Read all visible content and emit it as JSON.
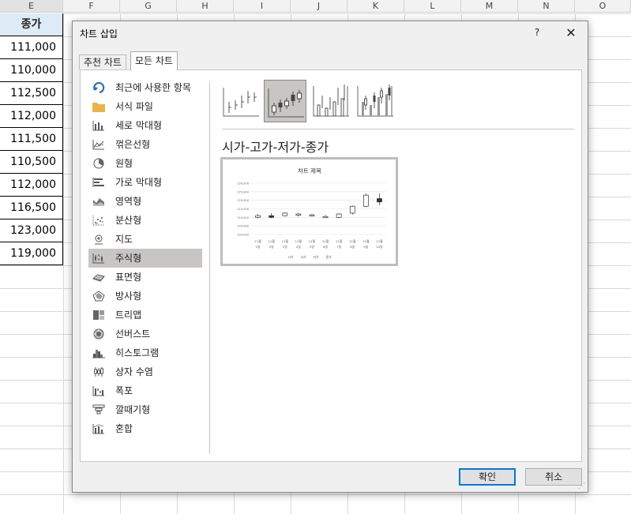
{
  "spreadsheet": {
    "columns": [
      "E",
      "F",
      "G",
      "H",
      "I",
      "J",
      "K",
      "L",
      "M",
      "N",
      "O"
    ],
    "header_cell": "종가",
    "values": [
      "111,000",
      "110,000",
      "112,500",
      "112,000",
      "111,500",
      "110,500",
      "112,000",
      "116,500",
      "123,000",
      "119,000"
    ]
  },
  "dialog": {
    "title": "차트 삽입",
    "help": "?",
    "close": "✕",
    "tabs": [
      {
        "label": "추천 차트",
        "active": false
      },
      {
        "label": "모든 차트",
        "active": true
      }
    ],
    "categories": [
      {
        "label": "최근에 사용한 항목",
        "icon": "recent-icon"
      },
      {
        "label": "서식 파일",
        "icon": "folder-icon"
      },
      {
        "label": "세로 막대형",
        "icon": "column-chart-icon"
      },
      {
        "label": "꺾은선형",
        "icon": "line-chart-icon"
      },
      {
        "label": "원형",
        "icon": "pie-chart-icon"
      },
      {
        "label": "가로 막대형",
        "icon": "bar-chart-icon"
      },
      {
        "label": "영역형",
        "icon": "area-chart-icon"
      },
      {
        "label": "분산형",
        "icon": "scatter-chart-icon"
      },
      {
        "label": "지도",
        "icon": "map-icon"
      },
      {
        "label": "주식형",
        "icon": "stock-chart-icon"
      },
      {
        "label": "표면형",
        "icon": "surface-chart-icon"
      },
      {
        "label": "방사형",
        "icon": "radar-chart-icon"
      },
      {
        "label": "트리맵",
        "icon": "treemap-icon"
      },
      {
        "label": "선버스트",
        "icon": "sunburst-icon"
      },
      {
        "label": "히스토그램",
        "icon": "histogram-icon"
      },
      {
        "label": "상자 수염",
        "icon": "box-whisker-icon"
      },
      {
        "label": "폭포",
        "icon": "waterfall-icon"
      },
      {
        "label": "깔때기형",
        "icon": "funnel-icon"
      },
      {
        "label": "혼합",
        "icon": "combo-chart-icon"
      }
    ],
    "selected_category": "주식형",
    "subtypes": [
      "고가-저가-종가",
      "시가-고가-저가-종가",
      "거래량-고가-저가-종가",
      "거래량-시가-고가-저가-종가"
    ],
    "selected_subtype_title": "시가-고가-저가-종가",
    "ok_label": "확인",
    "cancel_label": "취소"
  },
  "chart_data": {
    "type": "candlestick",
    "title": "차트 제목",
    "x_labels": [
      [
        "11월",
        "1일"
      ],
      [
        "11월",
        "2일"
      ],
      [
        "11월",
        "3일"
      ],
      [
        "11월",
        "4일"
      ],
      [
        "11월",
        "5일"
      ],
      [
        "11월",
        "6일"
      ],
      [
        "11월",
        "7일"
      ],
      [
        "11월",
        "8일"
      ],
      [
        "11월",
        "9일"
      ],
      [
        "11월",
        "10일"
      ]
    ],
    "y_ticks": [
      "130,000",
      "125,000",
      "120,000",
      "115,000",
      "110,000",
      "105,000",
      "100,000"
    ],
    "ylim": [
      100000,
      130000
    ],
    "legend": [
      "시가",
      "고가",
      "저가",
      "종가"
    ],
    "series": {
      "open": [
        110000,
        111000,
        111000,
        112000,
        111000,
        110500,
        110000,
        112500,
        116500,
        121000
      ],
      "high": [
        112000,
        112500,
        113000,
        112500,
        112000,
        111500,
        112500,
        117000,
        124000,
        124000
      ],
      "low": [
        109500,
        109500,
        110500,
        110500,
        110500,
        110000,
        109500,
        111500,
        116000,
        117000
      ],
      "close": [
        111000,
        110000,
        112500,
        112000,
        111500,
        110500,
        112000,
        116500,
        123000,
        119000
      ]
    }
  }
}
